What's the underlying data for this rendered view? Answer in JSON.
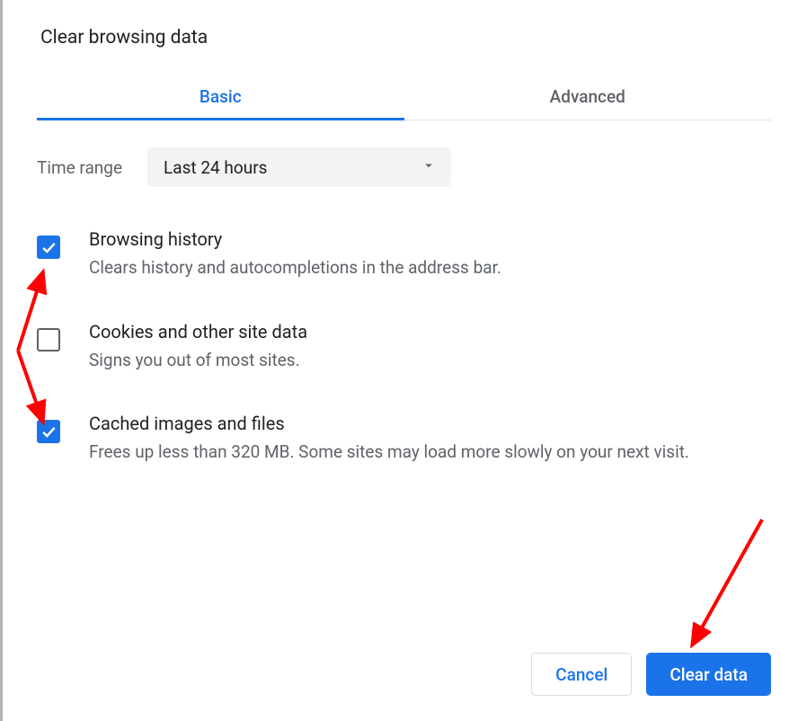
{
  "dialog": {
    "title": "Clear browsing data"
  },
  "tabs": {
    "basic": "Basic",
    "advanced": "Advanced"
  },
  "timeRange": {
    "label": "Time range",
    "value": "Last 24 hours"
  },
  "options": {
    "browsingHistory": {
      "title": "Browsing history",
      "description": "Clears history and autocompletions in the address bar.",
      "checked": true
    },
    "cookies": {
      "title": "Cookies and other site data",
      "description": "Signs you out of most sites.",
      "checked": false
    },
    "cache": {
      "title": "Cached images and files",
      "description": "Frees up less than 320 MB. Some sites may load more slowly on your next visit.",
      "checked": true
    }
  },
  "buttons": {
    "cancel": "Cancel",
    "clear": "Clear data"
  }
}
